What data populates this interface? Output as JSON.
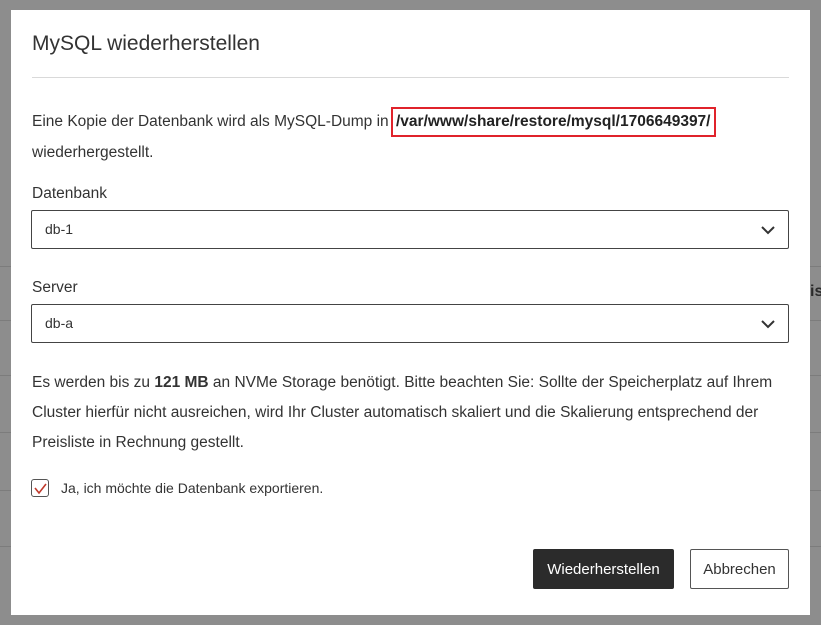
{
  "background": {
    "right_fragment": "is"
  },
  "dialog": {
    "title": "MySQL wiederherstellen",
    "intro_before": "Eine Kopie der Datenbank wird als MySQL-Dump in",
    "path": "/var/www/share/restore/mysql/1706649397/",
    "intro_after": "wiederhergestellt.",
    "database": {
      "label": "Datenbank",
      "value": "db-1"
    },
    "server": {
      "label": "Server",
      "value": "db-a"
    },
    "note_before": "Es werden bis zu ",
    "note_amount": "121 MB",
    "note_after": " an NVMe Storage benötigt. Bitte beachten Sie: Sollte der Speicherplatz auf Ihrem Cluster hierfür nicht ausreichen, wird Ihr Cluster automatisch skaliert und die Skalierung entsprechend der Preisliste in Rechnung gestellt.",
    "checkbox": {
      "label": "Ja, ich möchte die Datenbank exportieren.",
      "checked": true
    },
    "buttons": {
      "restore": "Wiederherstellen",
      "cancel": "Abbrechen"
    }
  },
  "colors": {
    "highlight": "#e0232b",
    "primary_button": "#2b2b2b",
    "checkmark": "#c0392b"
  }
}
